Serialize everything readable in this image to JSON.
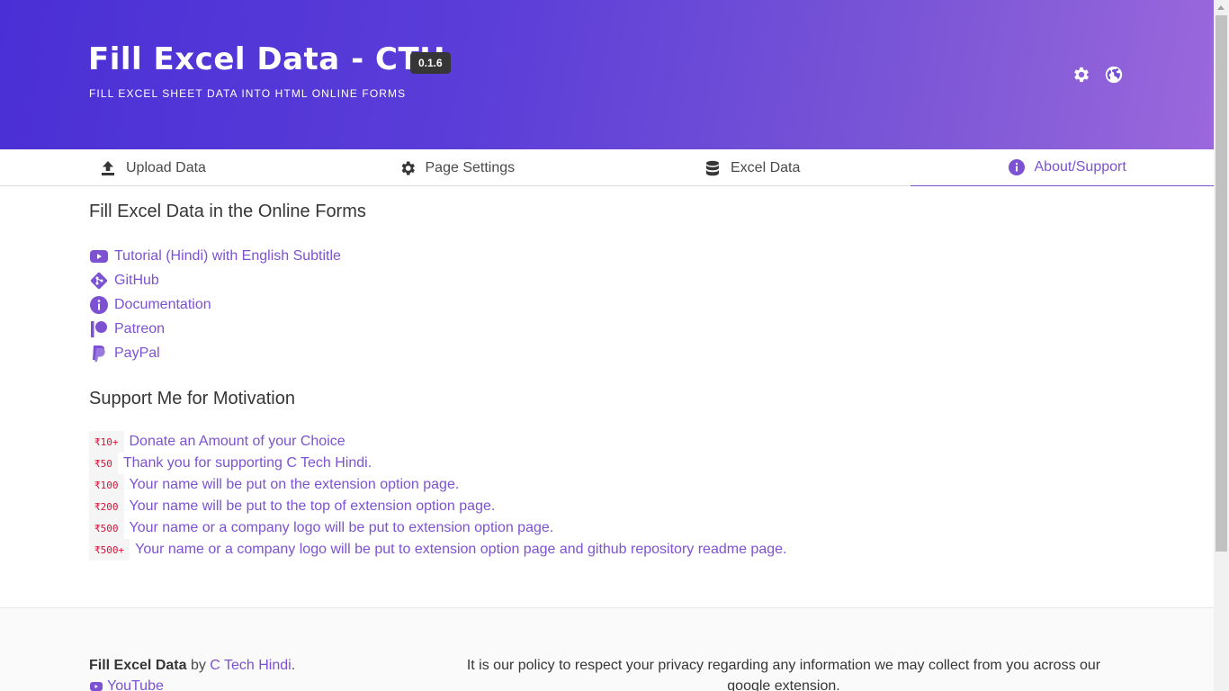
{
  "header": {
    "title": "Fill Excel Data - CTH",
    "version": "0.1.6",
    "subtitle": "FILL EXCEL SHEET DATA INTO HTML ONLINE FORMS",
    "icons": [
      "gear-icon",
      "globe-icon"
    ],
    "gradient_start": "#4a2fd6",
    "gradient_end": "#9b68dc"
  },
  "tabs": [
    {
      "label": "Upload Data",
      "icon": "upload-icon",
      "active": false
    },
    {
      "label": "Page Settings",
      "icon": "gear-icon",
      "active": false
    },
    {
      "label": "Excel Data",
      "icon": "database-icon",
      "active": false
    },
    {
      "label": "About/Support",
      "icon": "info-icon",
      "active": true
    }
  ],
  "about": {
    "title": "Fill Excel Data in the Online Forms",
    "links": [
      {
        "label": "Tutorial (Hindi) with English Subtitle",
        "icon": "youtube-icon"
      },
      {
        "label": "GitHub",
        "icon": "git-icon"
      },
      {
        "label": "Documentation",
        "icon": "info-icon"
      },
      {
        "label": "Patreon",
        "icon": "patreon-icon"
      },
      {
        "label": "PayPal",
        "icon": "paypal-icon"
      }
    ]
  },
  "support": {
    "title": "Support Me for Motivation",
    "items": [
      {
        "amount": "₹10+",
        "text": "Donate an Amount of your Choice"
      },
      {
        "amount": "₹50",
        "text": "Thank you for supporting C Tech Hindi."
      },
      {
        "amount": "₹100",
        "text": "Your name will be put on the extension option page."
      },
      {
        "amount": "₹200",
        "text": "Your name will be put to the top of extension option page."
      },
      {
        "amount": "₹500",
        "text": "Your name or a company logo will be put to extension option page."
      },
      {
        "amount": "₹500+",
        "text": "Your name or a company logo will be put to extension option page and github repository readme page."
      }
    ]
  },
  "footer": {
    "brand": "Fill Excel Data",
    "by": " by ",
    "author": "C Tech Hindi",
    "period": ".",
    "youtube": "YouTube",
    "policy": "It is our policy to respect your privacy regarding any information we may collect from you across our google extension."
  },
  "colors": {
    "accent": "#7c52d2",
    "amount": "#da1039"
  }
}
